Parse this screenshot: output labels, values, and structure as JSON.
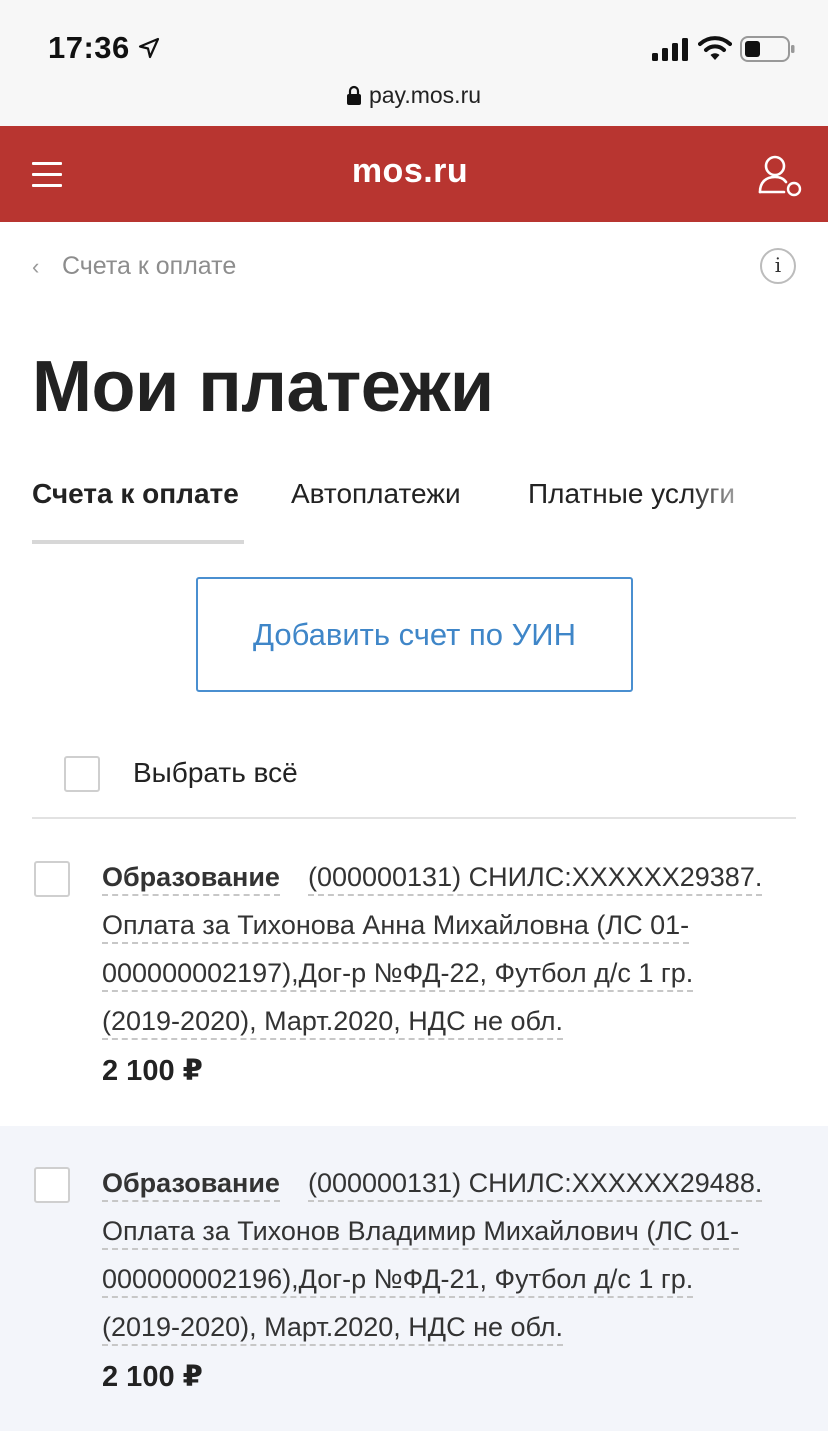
{
  "status_bar": {
    "time": "17:36",
    "url": "pay.mos.ru",
    "icons": [
      "location-arrow-icon",
      "signal-icon",
      "wifi-icon",
      "battery-icon",
      "lock-icon"
    ]
  },
  "header": {
    "brand": "mos.ru",
    "color": "#b83530",
    "icons": [
      "hamburger-menu-icon",
      "user-icon"
    ]
  },
  "breadcrumb": {
    "label": "Счета к оплате",
    "chevron": "‹",
    "info_glyph": "i"
  },
  "page_title": "Мои платежи",
  "tabs": [
    {
      "label": "Счета к оплате",
      "active": true
    },
    {
      "label": "Автоплатежи",
      "active": false
    },
    {
      "label": "Платные услуги",
      "active": false
    }
  ],
  "add_button_label": "Добавить счет по УИН",
  "select_all_label": "Выбрать всё",
  "bills": [
    {
      "category": "Образование",
      "line1": "(000000131) СНИЛС:XXXXXX29387.",
      "line2": "Оплата за Тихонова Анна Михайловна (ЛС 01-",
      "line3": "000000002197),Дог-р №ФД-22, Футбол д/с 1 гр.",
      "line4": "(2019-2020), Март.2020, НДС не обл.",
      "amount": "2 100 ₽",
      "checked": false
    },
    {
      "category": "Образование",
      "line1": "(000000131) СНИЛС:XXXXXX29488.",
      "line2": "Оплата за Тихонов Владимир Михайлович (ЛС 01-",
      "line3": "000000002196),Дог-р №ФД-21, Футбол д/с 1 гр.",
      "line4": "(2019-2020), Март.2020, НДС не обл.",
      "amount": "2 100 ₽",
      "checked": false
    }
  ],
  "colors": {
    "accent_blue": "#3f86c8",
    "header_red": "#b83530",
    "alt_row_bg": "#f3f5fa"
  }
}
